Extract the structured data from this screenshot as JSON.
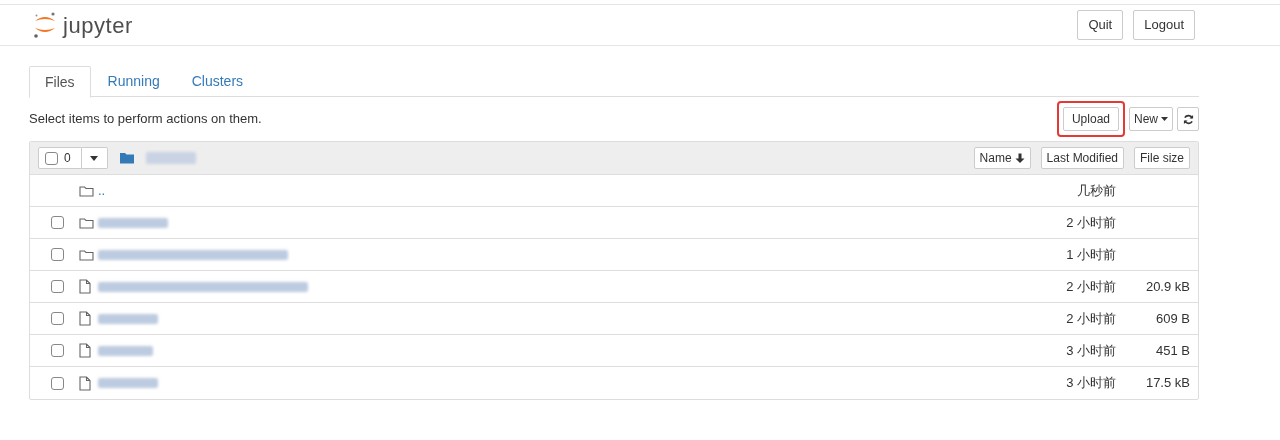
{
  "header": {
    "logo_text": "jupyter",
    "buttons": [
      "Quit",
      "Logout"
    ]
  },
  "tabs": [
    {
      "label": "Files",
      "selected": true
    },
    {
      "label": "Running",
      "selected": false
    },
    {
      "label": "Clusters",
      "selected": false
    }
  ],
  "toolbar": {
    "hint": "Select items to perform actions on them.",
    "upload": {
      "label": "Upload",
      "highlighted": true
    },
    "new_label": "New"
  },
  "list_header": {
    "select_all": {
      "checked": false,
      "count": "0"
    },
    "sort_buttons": [
      {
        "label": "Name",
        "sorted": true
      },
      {
        "label": "Last Modified",
        "sorted": false
      },
      {
        "label": "File size",
        "sorted": false
      }
    ]
  },
  "rows": [
    {
      "kind": "parent",
      "name": "..",
      "modified": "几秒前"
    },
    {
      "kind": "folder",
      "checked": false,
      "modified": "2 小时前"
    },
    {
      "kind": "folder",
      "checked": false,
      "modified": "1 小时前"
    },
    {
      "kind": "file",
      "checked": false,
      "modified": "2 小时前",
      "size": "20.9 kB"
    },
    {
      "kind": "file",
      "checked": false,
      "modified": "2 小时前",
      "size": "609 B"
    },
    {
      "kind": "file",
      "checked": false,
      "modified": "3 小时前",
      "size": "451 B"
    },
    {
      "kind": "file",
      "checked": false,
      "modified": "3 小时前",
      "size": "17.5 kB"
    }
  ]
}
